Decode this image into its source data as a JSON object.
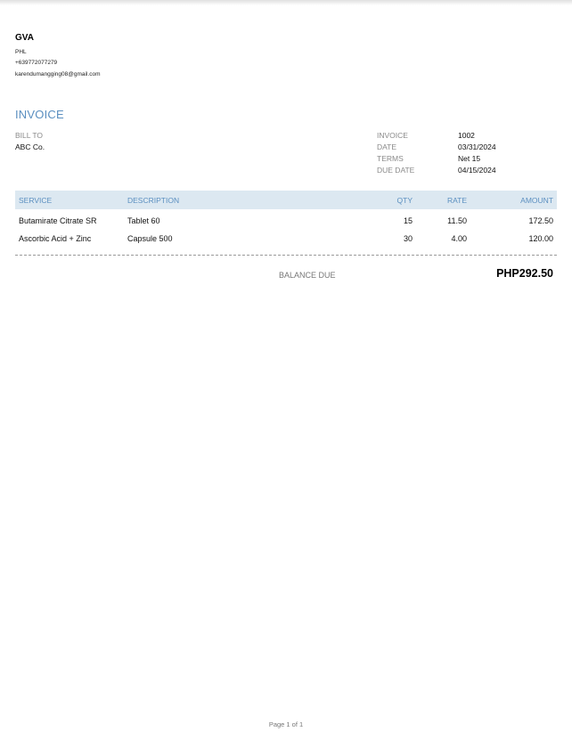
{
  "company": {
    "name": "GVA",
    "country": "PHL",
    "phone": "+639772077279",
    "email": "karendumangging08@gmail.com"
  },
  "document": {
    "title": "INVOICE",
    "bill_to_label": "BILL TO",
    "bill_to_value": "ABC Co."
  },
  "meta": {
    "invoice_label": "INVOICE",
    "invoice_value": "1002",
    "date_label": "DATE",
    "date_value": "03/31/2024",
    "terms_label": "TERMS",
    "terms_value": "Net 15",
    "due_date_label": "DUE DATE",
    "due_date_value": "04/15/2024"
  },
  "table": {
    "headers": {
      "service": "SERVICE",
      "description": "DESCRIPTION",
      "qty": "QTY",
      "rate": "RATE",
      "amount": "AMOUNT"
    },
    "rows": [
      {
        "service": "Butamirate Citrate SR",
        "description": "Tablet 60",
        "qty": "15",
        "rate": "11.50",
        "amount": "172.50"
      },
      {
        "service": "Ascorbic Acid + Zinc",
        "description": "Capsule 500",
        "qty": "30",
        "rate": "4.00",
        "amount": "120.00"
      }
    ]
  },
  "balance": {
    "label": "BALANCE DUE",
    "value": "PHP292.50"
  },
  "footer": {
    "page": "Page 1 of 1"
  },
  "colors": {
    "accent": "#5b8fc0",
    "header_bg": "#dce8f1",
    "label_gray": "#8a8a8a"
  }
}
